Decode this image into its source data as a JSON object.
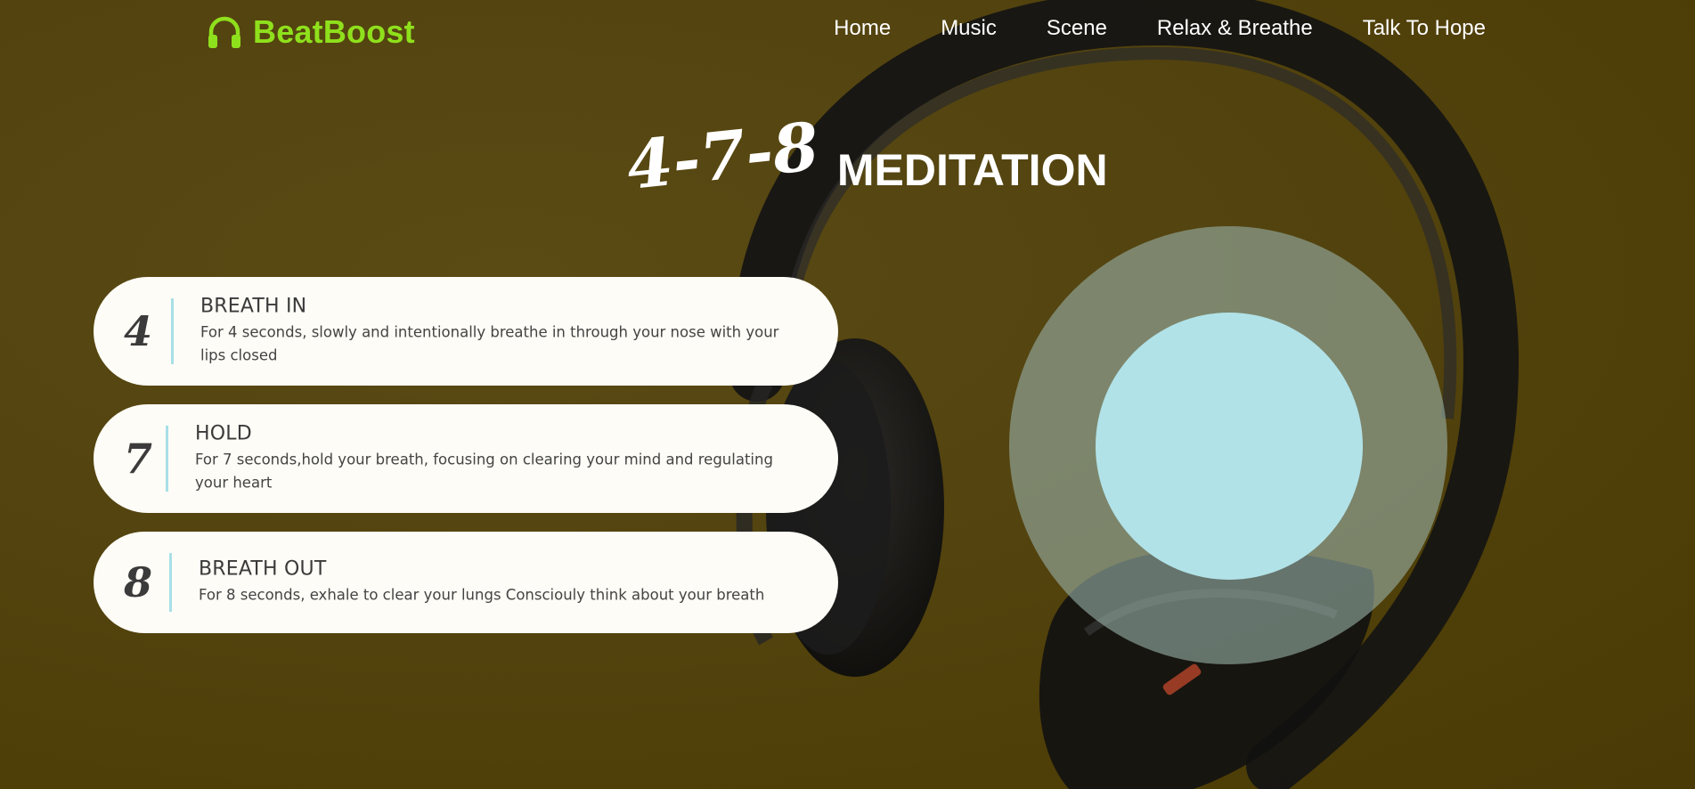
{
  "nav": {
    "brand": "BeatBoost",
    "brand_icon": "headphones-icon",
    "links": [
      "Home",
      "Music",
      "Scene",
      "Relax & Breathe",
      "Talk To Hope"
    ]
  },
  "hero": {
    "title_numbers": "4-7-8",
    "title_word": "MEDITATION"
  },
  "steps": [
    {
      "number": "4",
      "title": "BREATH IN",
      "description": "For 4 seconds, slowly and intentionally breathe in through your nose with your lips closed"
    },
    {
      "number": "7",
      "title": "HOLD",
      "description": "For 7 seconds,hold your breath, focusing on clearing your mind and regulating your heart"
    },
    {
      "number": "8",
      "title": "BREATH OUT",
      "description": "For 8 seconds, exhale to clear your lungs Consciouly think about your breath"
    }
  ],
  "colors": {
    "brand": "#8fe01c",
    "background": "#544410",
    "card": "#fdfcf6",
    "divider": "#a8dfe8",
    "breath_inner": "#b1e2e8"
  }
}
